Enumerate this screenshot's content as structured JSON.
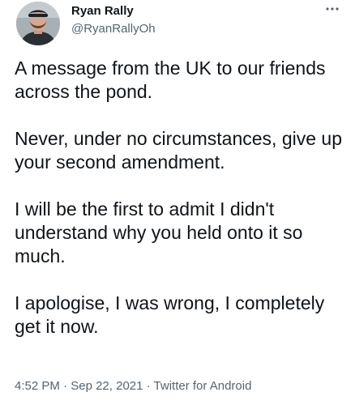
{
  "author": {
    "display_name": "Ryan Rally",
    "handle": "@RyanRallyOh",
    "avatar_icon": "avatar-photo"
  },
  "menu": {
    "icon": "more-options-icon",
    "glyph": "···"
  },
  "tweet": {
    "paragraphs": [
      "A message from the UK to our friends across the pond.",
      "Never, under no circumstances, give up your second amendment.",
      "I will be the first to admit I didn't understand why you held onto it so much.",
      "I apologise, I was wrong, I completely get it now."
    ],
    "time": "4:52 PM",
    "separator": " · ",
    "date": "Sep 22, 2021",
    "source": "Twitter for Android"
  },
  "colors": {
    "text": "#0f1419",
    "secondary": "#536471",
    "background": "#ffffff"
  }
}
